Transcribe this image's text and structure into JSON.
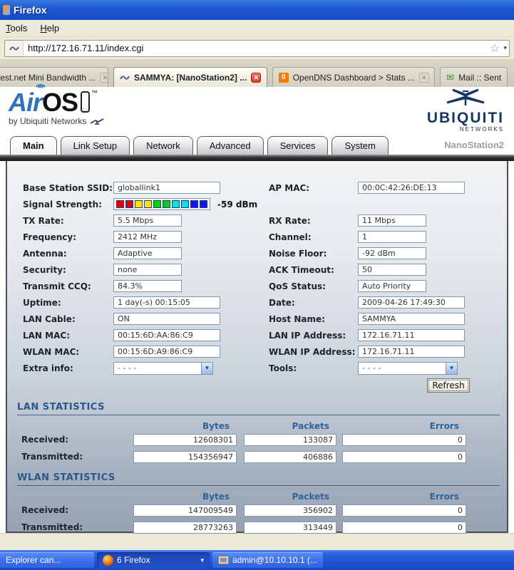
{
  "browser": {
    "window_title": "Firefox",
    "menu": [
      "Tools",
      "Help"
    ],
    "url": "http://172.16.71.11/index.cgi",
    "star_icon": "☆",
    "url_dropdown_icon": "▾",
    "tabs": [
      {
        "label": "test.net Mini Bandwidth ...",
        "icon": null,
        "active": false,
        "closable": true,
        "close_style": "gray",
        "cut": true
      },
      {
        "label": "SAMMYA: [NanoStation2] ...",
        "icon": "antenna",
        "active": true,
        "closable": true,
        "close_style": "red",
        "cut": false
      },
      {
        "label": "OpenDNS Dashboard > Stats ...",
        "icon": "opendns",
        "active": false,
        "closable": true,
        "close_style": "gray",
        "cut": false
      },
      {
        "label": "Mail :: Sent",
        "icon": "mail",
        "active": false,
        "closable": false,
        "close_style": "",
        "cut": false
      }
    ]
  },
  "header": {
    "logo_air": "Air",
    "logo_os": "OS",
    "logo_tm": "™",
    "byline": "by Ubiquiti Networks",
    "brand": "UBIQUITI",
    "brand_sub": "NETWORKS",
    "product": "NanoStation2"
  },
  "nav": {
    "tabs": [
      {
        "label": "Main",
        "active": true
      },
      {
        "label": "Link Setup",
        "active": false
      },
      {
        "label": "Network",
        "active": false
      },
      {
        "label": "Advanced",
        "active": false
      },
      {
        "label": "Services",
        "active": false
      },
      {
        "label": "System",
        "active": false
      }
    ]
  },
  "main": {
    "rows": [
      {
        "left": {
          "label": "Base Station SSID:",
          "value": "globallink1",
          "kind": "box",
          "size": "l"
        },
        "right": {
          "label": "AP MAC:",
          "value": "00:0C:42:26:DE:13",
          "kind": "box",
          "size": "l"
        }
      },
      {
        "left": {
          "label": "Signal Strength:",
          "kind": "signal"
        },
        "right": null
      },
      {
        "left": {
          "label": "TX Rate:",
          "value": "5.5 Mbps",
          "kind": "box",
          "size": "m"
        },
        "right": {
          "label": "RX Rate:",
          "value": "11 Mbps",
          "kind": "box",
          "size": "m"
        }
      },
      {
        "left": {
          "label": "Frequency:",
          "value": "2412 MHz",
          "kind": "box",
          "size": "m"
        },
        "right": {
          "label": "Channel:",
          "value": "1",
          "kind": "box",
          "size": "m"
        }
      },
      {
        "left": {
          "label": "Antenna:",
          "value": "Adaptive",
          "kind": "box",
          "size": "m"
        },
        "right": {
          "label": "Noise Floor:",
          "value": "-92 dBm",
          "kind": "box",
          "size": "m"
        }
      },
      {
        "left": {
          "label": "Security:",
          "value": "none",
          "kind": "box",
          "size": "m"
        },
        "right": {
          "label": "ACK Timeout:",
          "value": "50",
          "kind": "box",
          "size": "m"
        }
      },
      {
        "left": {
          "label": "Transmit CCQ:",
          "value": "84.3%",
          "kind": "box",
          "size": "m"
        },
        "right": {
          "label": "QoS Status:",
          "value": "Auto Priority",
          "kind": "box",
          "size": "m"
        }
      },
      {
        "left": {
          "label": "Uptime:",
          "value": "1 day(-s) 00:15:05",
          "kind": "box",
          "size": "l"
        },
        "right": {
          "label": "Date:",
          "value": "2009-04-26 17:49:30",
          "kind": "box",
          "size": "l"
        }
      },
      {
        "left": {
          "label": "LAN Cable:",
          "value": "ON",
          "kind": "box",
          "size": "l"
        },
        "right": {
          "label": "Host Name:",
          "value": "SAMMYA",
          "kind": "box",
          "size": "l"
        }
      },
      {
        "left": {
          "label": "LAN MAC:",
          "value": "00:15:6D:AA:86:C9",
          "kind": "box",
          "size": "l"
        },
        "right": {
          "label": "LAN IP Address:",
          "value": "172.16.71.11",
          "kind": "box",
          "size": "l"
        }
      },
      {
        "left": {
          "label": "WLAN MAC:",
          "value": "00:15:6D:A9:86:C9",
          "kind": "box",
          "size": "l"
        },
        "right": {
          "label": "WLAN IP Address:",
          "value": "172.16.71.11",
          "kind": "box",
          "size": "l"
        }
      },
      {
        "left": {
          "label": "Extra info:",
          "value": "- - - -",
          "kind": "select"
        },
        "right": {
          "label": "Tools:",
          "value": "- - - -",
          "kind": "select"
        }
      }
    ],
    "signal": {
      "reading": "-59 dBm",
      "colors": [
        "#e10000",
        "#e10000",
        "#ffe400",
        "#ffe400",
        "#00d300",
        "#00d300",
        "#00e4e4",
        "#00e4e4",
        "#1414ef",
        "#1414ef"
      ]
    },
    "refresh_label": "Refresh",
    "select_chevron": "▾"
  },
  "stats_sections": [
    {
      "title": "LAN STATISTICS",
      "columns": [
        "Bytes",
        "Packets",
        "Errors"
      ],
      "rows": [
        {
          "label": "Received:",
          "values": [
            "12608301",
            "133087",
            "0"
          ]
        },
        {
          "label": "Transmitted:",
          "values": [
            "154356947",
            "406886",
            "0"
          ]
        }
      ]
    },
    {
      "title": "WLAN STATISTICS",
      "columns": [
        "Bytes",
        "Packets",
        "Errors"
      ],
      "rows": [
        {
          "label": "Received:",
          "values": [
            "147009549",
            "356902",
            "0"
          ]
        },
        {
          "label": "Transmitted:",
          "values": [
            "28773263",
            "313449",
            "0"
          ]
        }
      ]
    }
  ],
  "taskbar": {
    "buttons": [
      {
        "label": "Explorer can...",
        "icon": null,
        "style": "cut",
        "arrow": null
      },
      {
        "label": "6 Firefox",
        "icon": "firefox",
        "style": "pressed",
        "arrow": "▾"
      },
      {
        "label": "admin@10.10.10.1 (...",
        "icon": "terminal",
        "style": "",
        "arrow": null
      }
    ]
  }
}
